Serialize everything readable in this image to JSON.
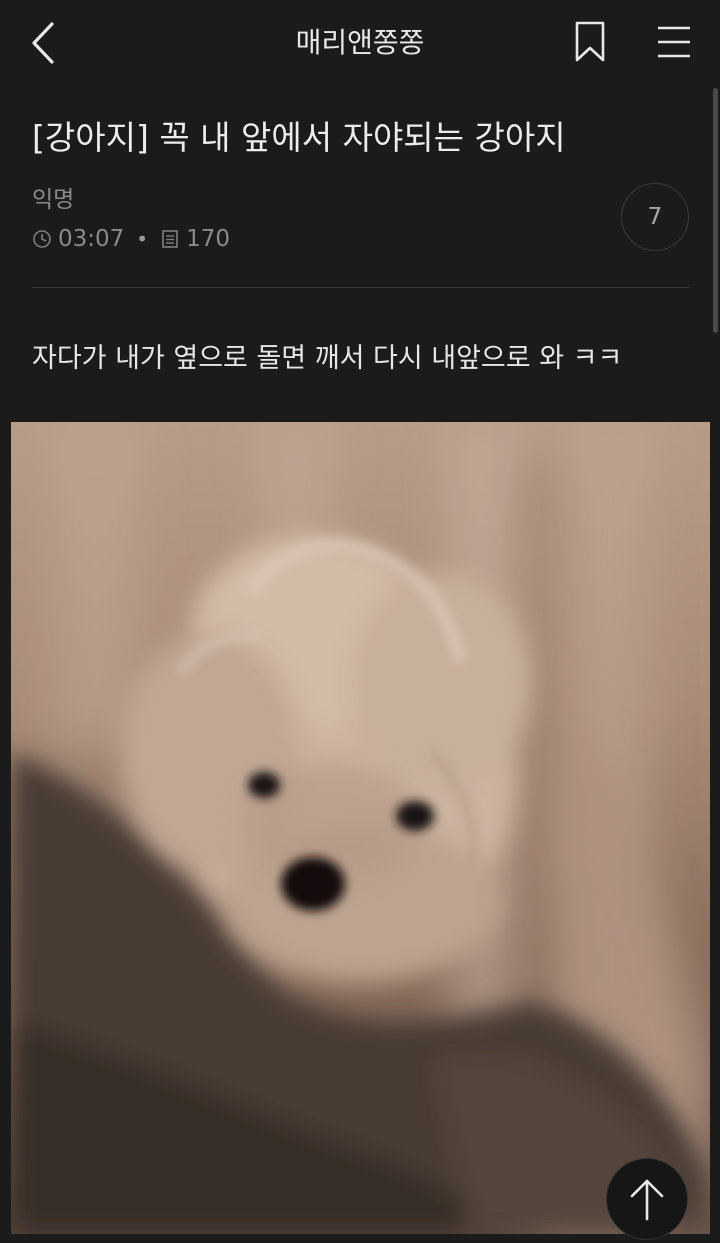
{
  "header": {
    "app_title": "매리앤쫑쫑"
  },
  "post": {
    "title": "[강아지] 꼭 내 앞에서 자야되는 강아지",
    "author": "익명",
    "time": "03:07",
    "views": "170",
    "comment_count": "7",
    "body": "자다가 내가 옆으로 돌면 깨서 다시 내앞으로 와 ㅋㅋ"
  },
  "icons": {
    "back": "chevron-left-icon",
    "bookmark": "bookmark-icon",
    "menu": "hamburger-menu-icon",
    "clock": "clock-icon",
    "views": "document-icon",
    "scroll_top": "arrow-up-icon"
  },
  "colors": {
    "background": "#1b1b1c",
    "text": "#eaeaea",
    "meta": "#8a8a8c",
    "divider": "#38383a"
  }
}
